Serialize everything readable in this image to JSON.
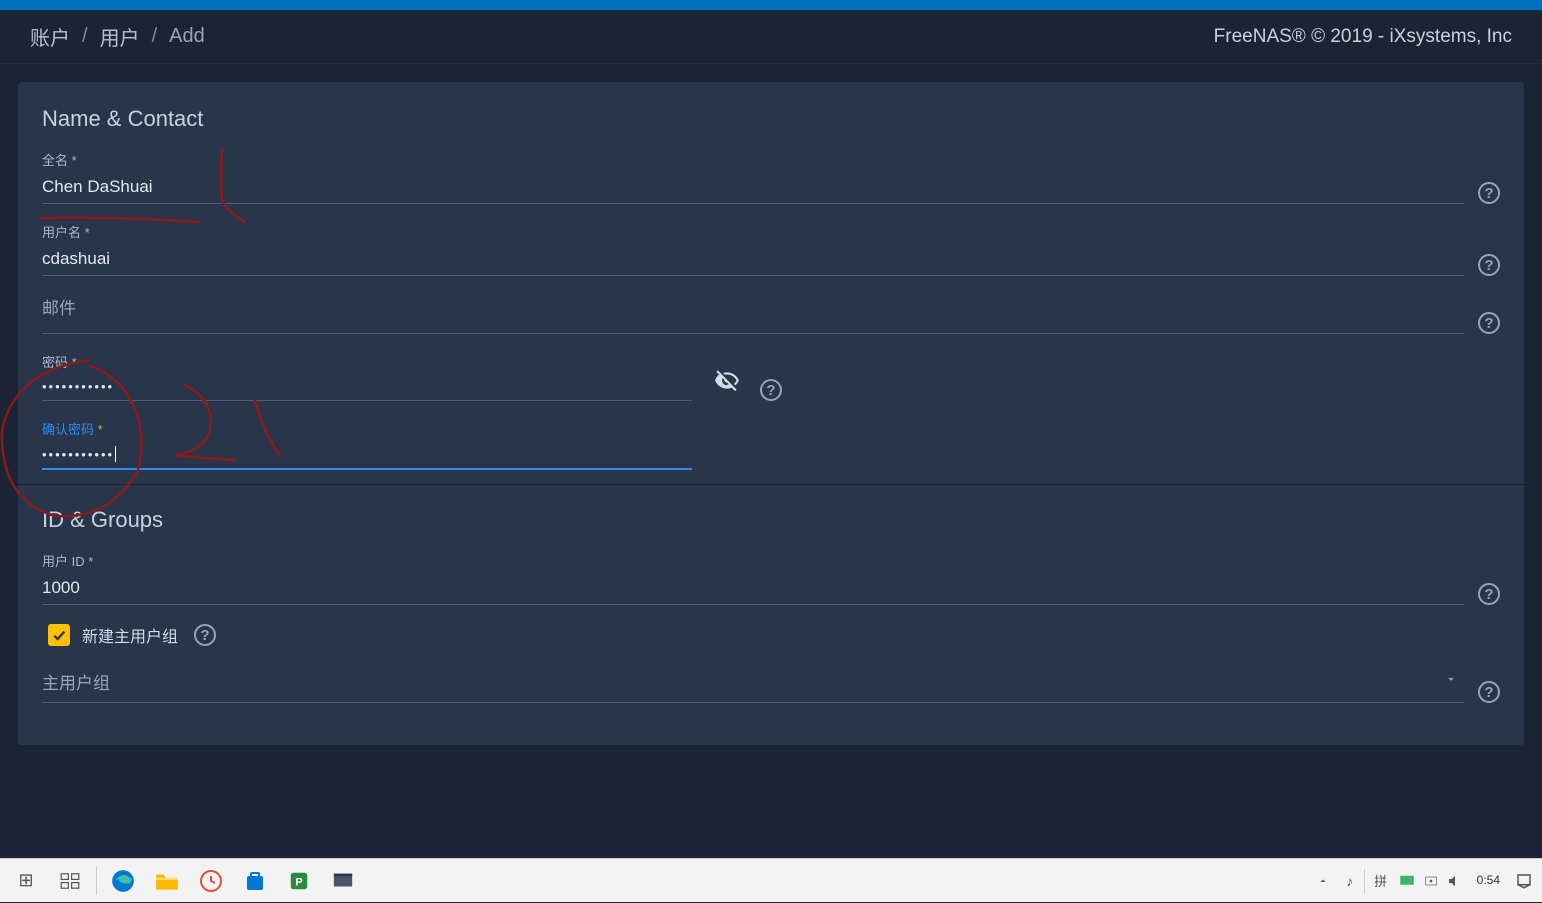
{
  "breadcrumb": {
    "items": [
      "账户",
      "用户",
      "Add"
    ]
  },
  "brand": "FreeNAS® © 2019 - iXsystems, Inc",
  "sections": {
    "name_contact": {
      "title": "Name & Contact",
      "fullname_label": "全名",
      "fullname_value": "Chen DaShuai",
      "username_label": "用户名",
      "username_value": "cdashuai",
      "email_label": "邮件",
      "email_value": "",
      "password_label": "密码",
      "password_value": "•••••••••••",
      "confirm_label": "确认密码",
      "confirm_value": "•••••••••••"
    },
    "id_groups": {
      "title": "ID & Groups",
      "userid_label": "用户 ID",
      "userid_value": "1000",
      "new_primary_group_label": "新建主用户组",
      "new_primary_group_checked": true,
      "primary_group_label": "主用户组"
    }
  },
  "taskbar": {
    "time": "0:54"
  }
}
